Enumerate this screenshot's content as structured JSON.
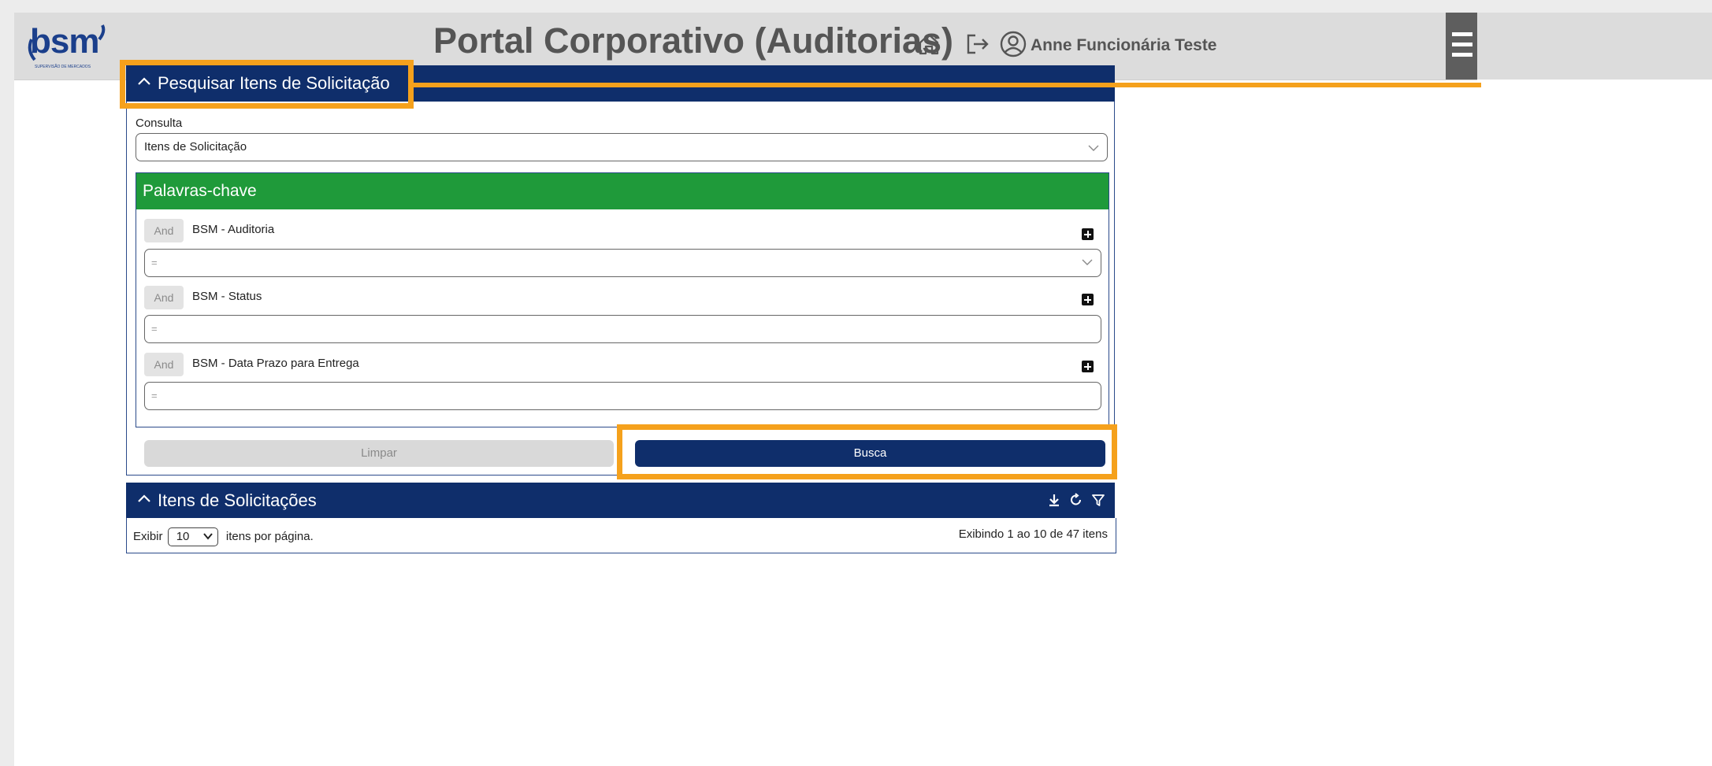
{
  "header": {
    "logo_text": "bsm",
    "logo_sub": "SUPERVISÃO DE MERCADOS",
    "title": "Portal Corporativo (Auditorias)",
    "user_name": "Anne Funcionária Teste",
    "icons": [
      "home-icon",
      "logout-icon",
      "user-circle-icon",
      "hamburger-menu-icon"
    ]
  },
  "search_panel": {
    "title": "Pesquisar Itens de Solicitação",
    "consulta_label": "Consulta",
    "consulta_value": "Itens de Solicitação",
    "keywords": {
      "title": "Palavras-chave",
      "items": [
        {
          "operator": "And",
          "name": "BSM - Auditoria",
          "value": "=",
          "is_select": true
        },
        {
          "operator": "And",
          "name": "BSM - Status",
          "value": "=",
          "is_select": false
        },
        {
          "operator": "And",
          "name": "BSM - Data Prazo para Entrega",
          "value": "=",
          "is_select": false
        }
      ]
    },
    "clear_label": "Limpar",
    "search_label": "Busca"
  },
  "results_panel": {
    "title": "Itens de Solicitações",
    "show_prefix": "Exibir",
    "page_size": "10",
    "show_suffix": "itens por página.",
    "count_text": "Exibindo 1 ao 10 de 47 itens",
    "icons": [
      "download-icon",
      "refresh-icon",
      "filter-icon"
    ]
  },
  "colors": {
    "primary": "#0f2e6b",
    "keyword_header": "#1f9a3a",
    "highlight": "#f5a11c",
    "topbar": "#dcdcdc"
  }
}
